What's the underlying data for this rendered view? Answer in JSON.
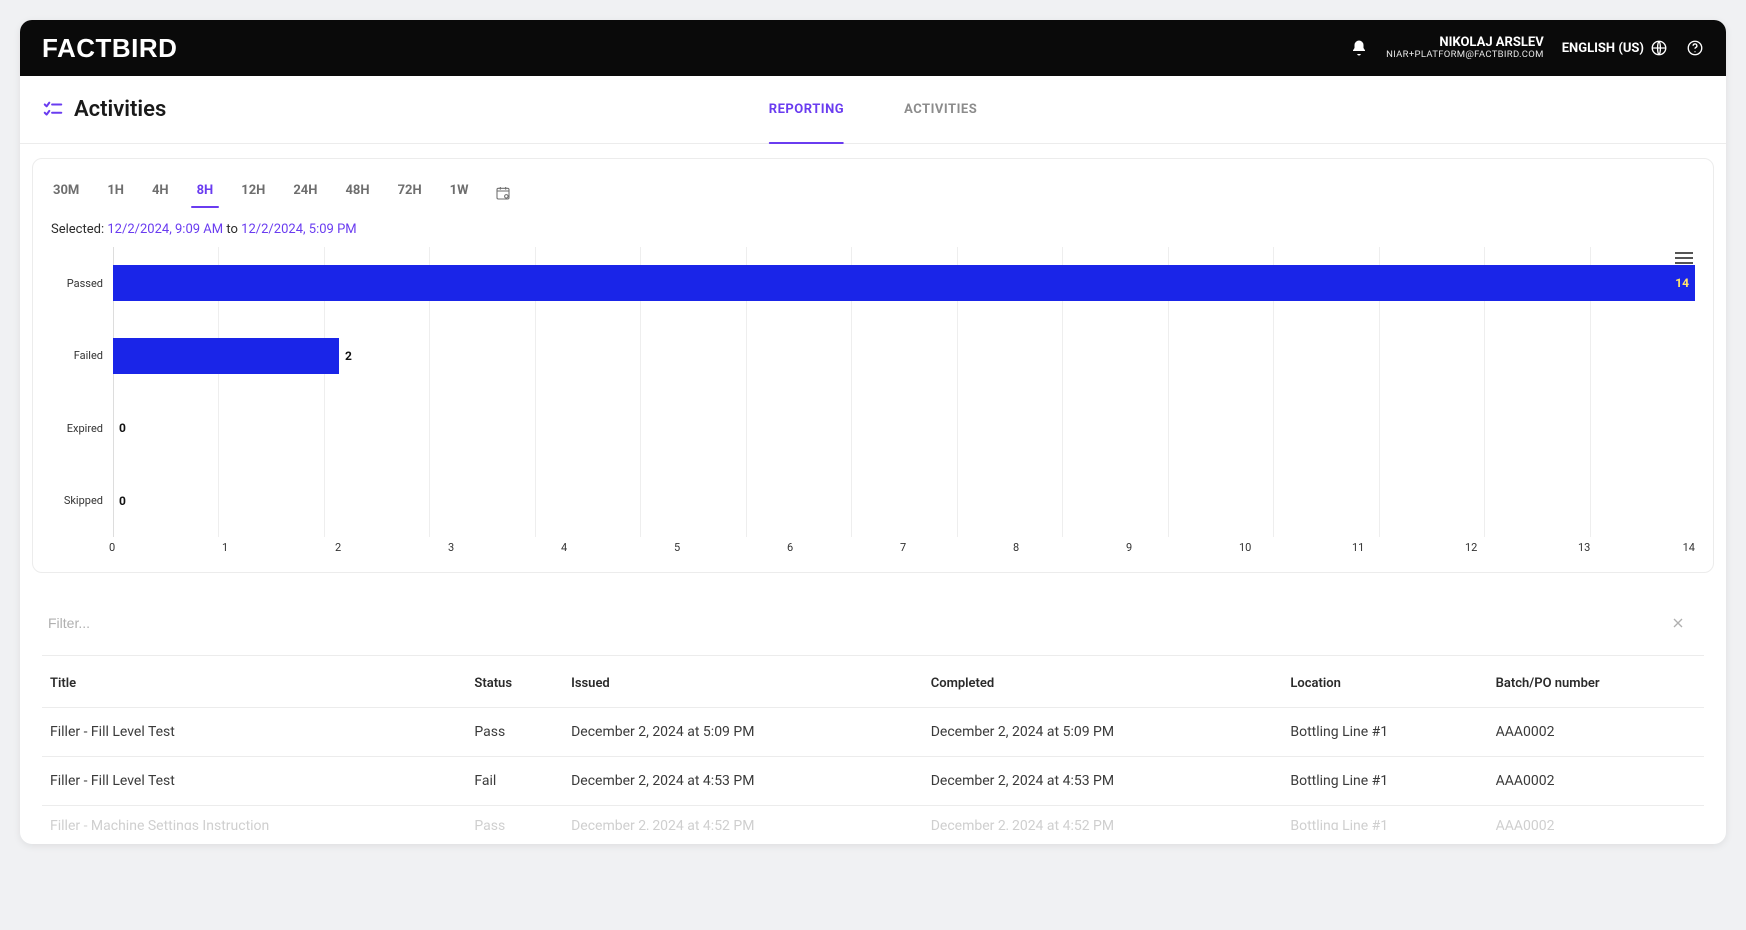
{
  "header": {
    "logo_text": "FACTBIRD",
    "user_name": "NIKOLAJ ARSLEV",
    "user_email": "NIAR+PLATFORM@FACTBIRD.COM",
    "language": "ENGLISH (US)"
  },
  "page": {
    "title": "Activities",
    "tabs": [
      {
        "label": "REPORTING",
        "active": true
      },
      {
        "label": "ACTIVITIES",
        "active": false
      }
    ]
  },
  "range_tabs": [
    "30M",
    "1H",
    "4H",
    "8H",
    "12H",
    "24H",
    "48H",
    "72H",
    "1W"
  ],
  "range_active": "8H",
  "selected": {
    "prefix": "Selected:",
    "from": "12/2/2024, 9:09 AM",
    "mid": "to",
    "to": "12/2/2024, 5:09 PM"
  },
  "chart_data": {
    "type": "bar",
    "orientation": "horizontal",
    "categories": [
      "Passed",
      "Failed",
      "Expired",
      "Skipped"
    ],
    "values": [
      14,
      2,
      0,
      0
    ],
    "xlim": [
      0,
      14
    ],
    "xticks": [
      0,
      1,
      2,
      3,
      4,
      5,
      6,
      7,
      8,
      9,
      10,
      11,
      12,
      13,
      14
    ],
    "bar_color": "#1a25e8"
  },
  "filter_placeholder": "Filter...",
  "table": {
    "columns": [
      "Title",
      "Status",
      "Issued",
      "Completed",
      "Location",
      "Batch/PO number"
    ],
    "rows": [
      {
        "title": "Filler - Fill Level Test",
        "status": "Pass",
        "issued": "December 2, 2024 at 5:09 PM",
        "completed": "December 2, 2024 at 5:09 PM",
        "location": "Bottling Line #1",
        "batch": "AAA0002"
      },
      {
        "title": "Filler - Fill Level Test",
        "status": "Fail",
        "issued": "December 2, 2024 at 4:53 PM",
        "completed": "December 2, 2024 at 4:53 PM",
        "location": "Bottling Line #1",
        "batch": "AAA0002"
      },
      {
        "title": "Filler - Machine Settings Instruction",
        "status": "Pass",
        "issued": "December 2, 2024 at 4:52 PM",
        "completed": "December 2, 2024 at 4:52 PM",
        "location": "Bottling Line #1",
        "batch": "AAA0002"
      }
    ]
  }
}
